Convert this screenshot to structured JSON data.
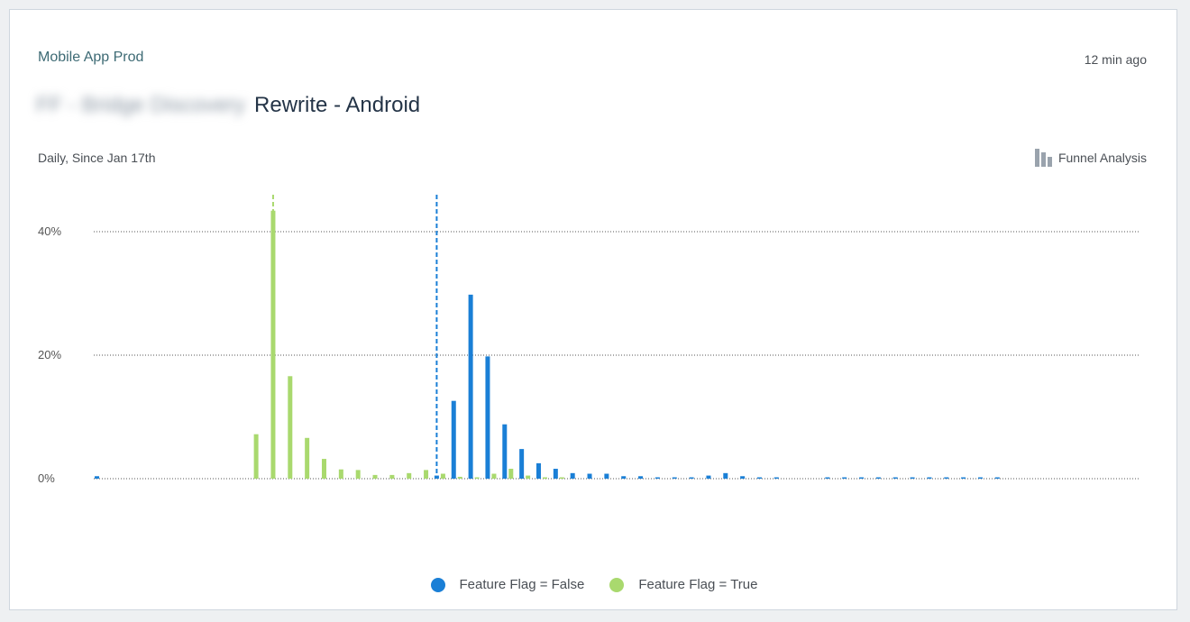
{
  "header": {
    "project": "Mobile App Prod",
    "updated": "12 min ago",
    "title_redacted": "FF - Bridge Discovery",
    "title": "Rewrite  - Android",
    "subtitle": "Daily, Since Jan 17th",
    "funnel_label": "Funnel Analysis",
    "funnel_icon": "funnel-bars-icon"
  },
  "colors": {
    "false_series": "#1a7fd6",
    "true_series": "#a9d96e",
    "gridline": "#555555",
    "axis_text": "#555555"
  },
  "legend": [
    {
      "label": "Feature Flag = False",
      "color": "#1a7fd6"
    },
    {
      "label": "Feature Flag = True",
      "color": "#a9d96e"
    }
  ],
  "chart_data": {
    "type": "bar",
    "ylim": [
      0,
      0.4
    ],
    "yticks": [
      0,
      0.2,
      0.4
    ],
    "ytick_labels": [
      "0%",
      "20%",
      "40%"
    ],
    "grid": true,
    "legend_position": "bottom",
    "series": [
      {
        "name": "Feature Flag = False",
        "color": "#1a7fd6",
        "values": [
          0.004,
          0,
          0,
          0,
          0,
          0,
          0,
          0,
          0,
          0,
          0,
          0,
          0,
          0,
          0,
          0,
          0,
          0,
          0,
          0,
          0.005,
          0.126,
          0.298,
          0.198,
          0.088,
          0.048,
          0.025,
          0.016,
          0.009,
          0.008,
          0.008,
          0.004,
          0.004,
          0.001,
          0.001,
          0.001,
          0.005,
          0.009,
          0.004,
          0.001,
          0.001,
          0,
          0,
          0.002,
          0.001,
          0.001,
          0.001,
          0.001,
          0.001,
          0.001,
          0.001,
          0.001,
          0.001,
          0.001,
          0,
          0,
          0,
          0,
          0,
          0,
          0,
          0
        ]
      },
      {
        "name": "Feature Flag = True",
        "color": "#a9d96e",
        "values": [
          0,
          0,
          0,
          0,
          0,
          0,
          0,
          0,
          0,
          0,
          0.072,
          0.434,
          0.166,
          0.066,
          0.032,
          0.015,
          0.014,
          0.006,
          0.006,
          0.009,
          0.014,
          0.008,
          0.003,
          0.002,
          0.008,
          0.016,
          0.005,
          0.002,
          0.001,
          0,
          0,
          0,
          0,
          0,
          0,
          0,
          0,
          0,
          0,
          0,
          0,
          0,
          0,
          0,
          0,
          0,
          0,
          0,
          0,
          0,
          0,
          0,
          0,
          0,
          0,
          0,
          0,
          0,
          0,
          0,
          0,
          0
        ]
      }
    ],
    "markers": [
      {
        "series": "Feature Flag = True",
        "index": 11
      },
      {
        "series": "Feature Flag = False",
        "index": 20
      }
    ]
  }
}
